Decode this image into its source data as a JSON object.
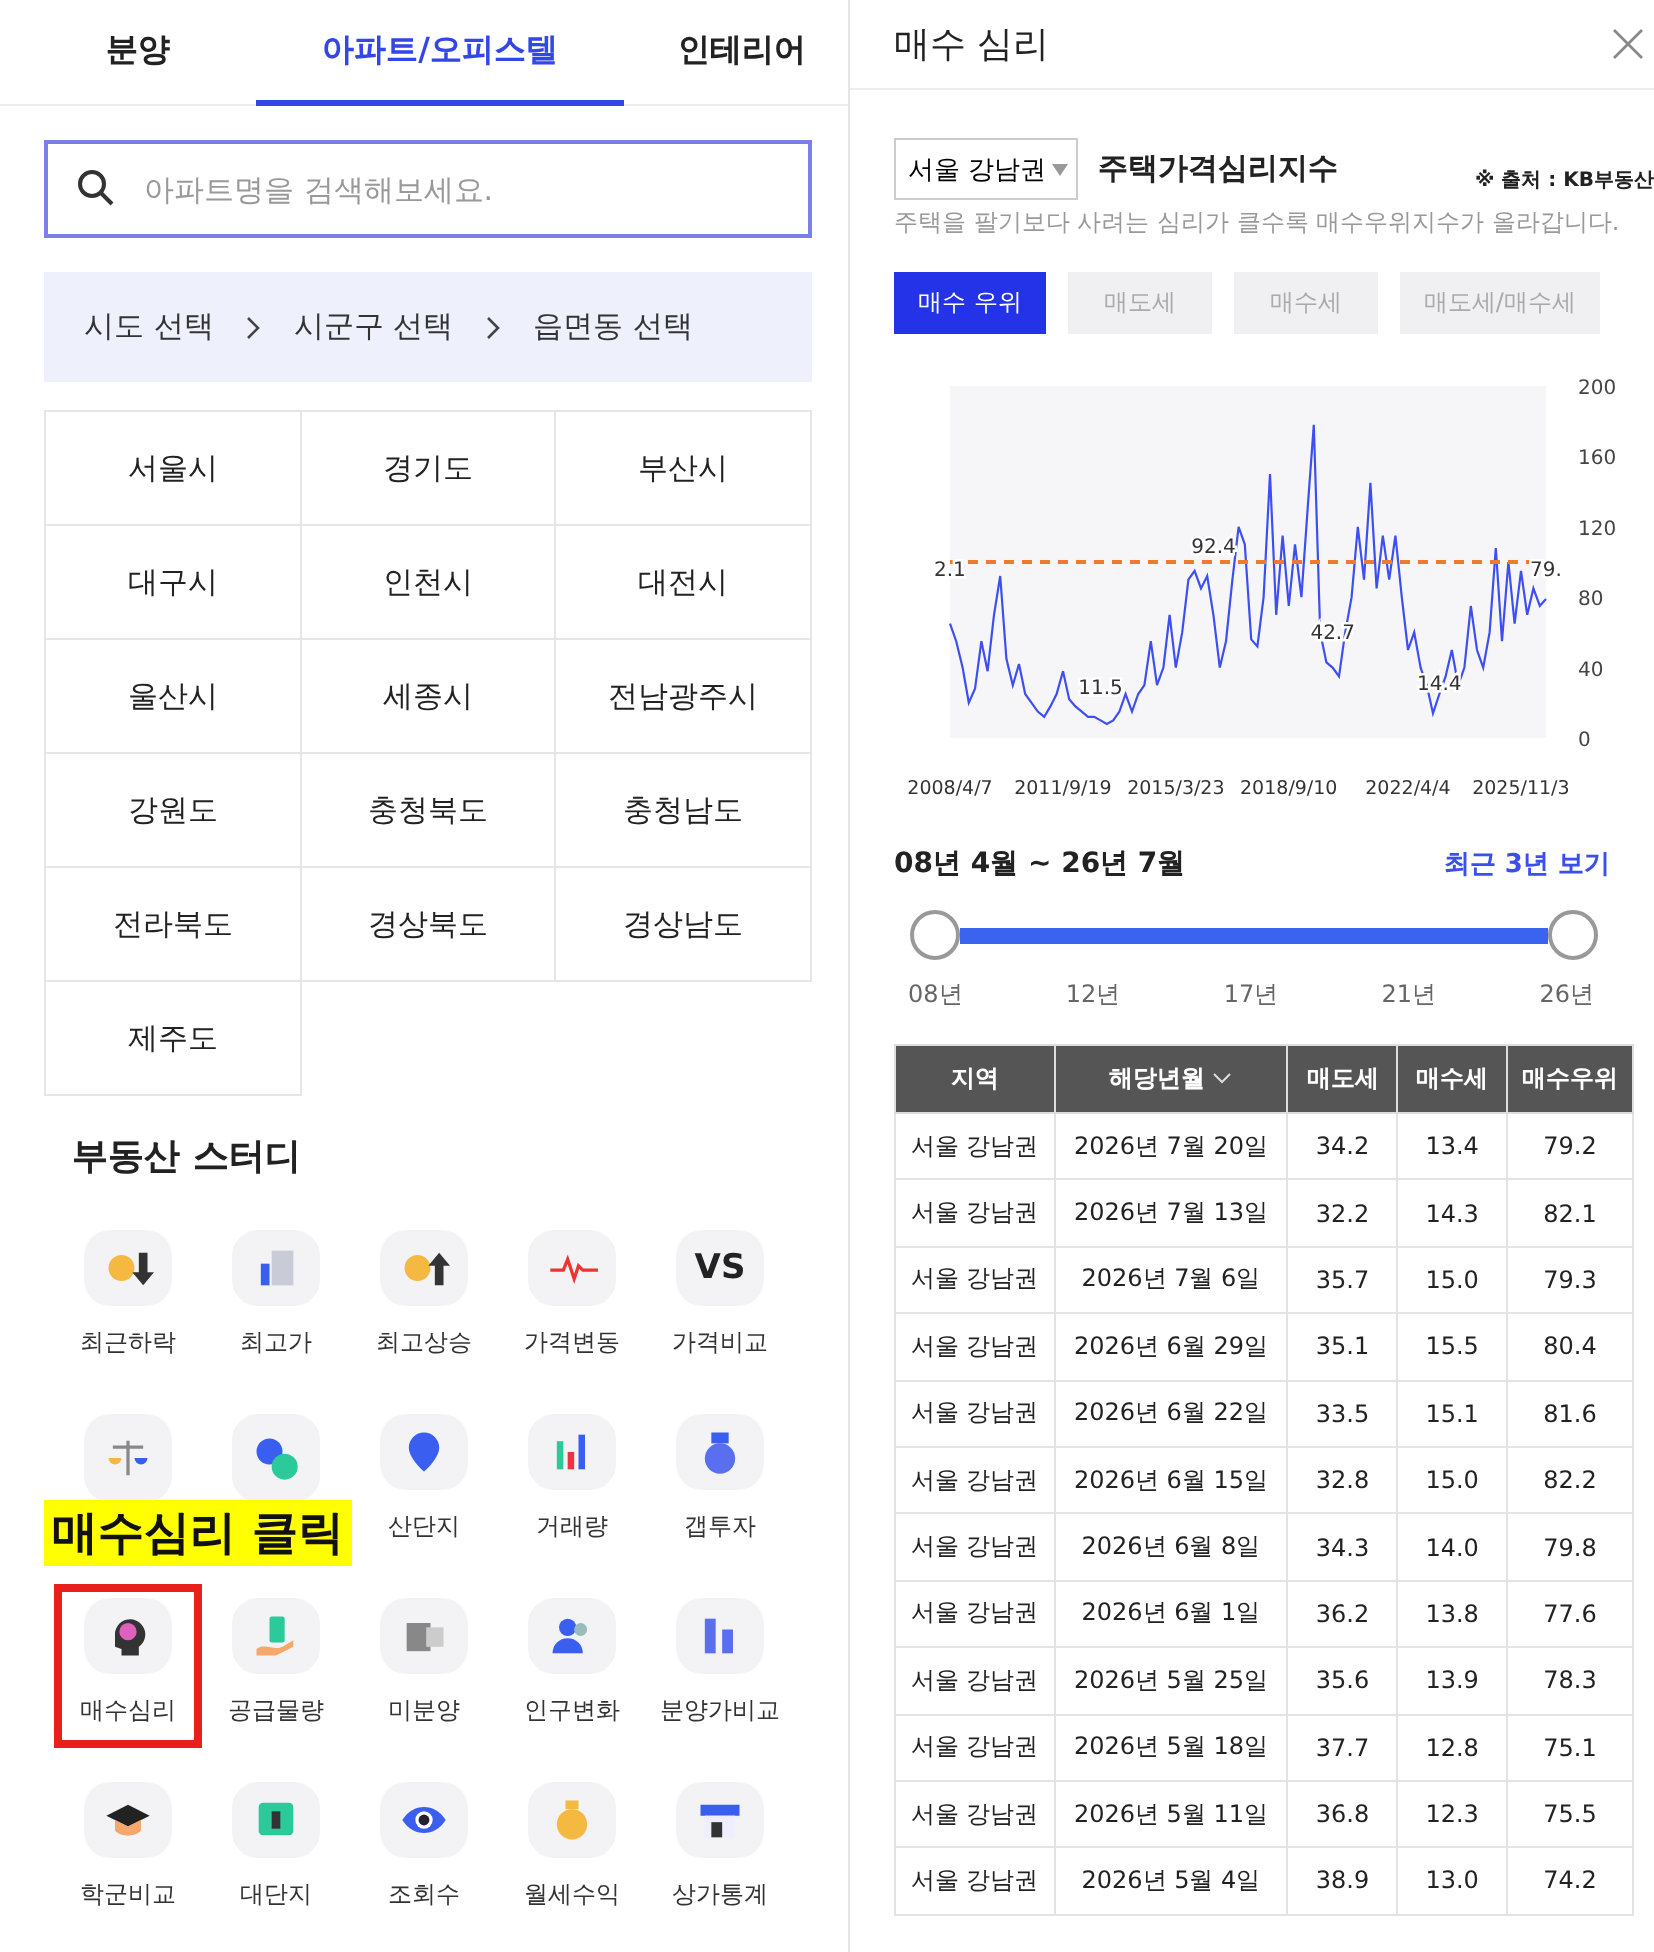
{
  "left_panel": {
    "tabs": [
      {
        "label": "분양",
        "selected": false
      },
      {
        "label": "아파트/오피스텔",
        "selected": true
      },
      {
        "label": "인테리어",
        "selected": false
      }
    ],
    "search": {
      "placeholder": "아파트명을 검색해보세요."
    },
    "breadcrumb": [
      "시도 선택",
      "시군구 선택",
      "읍면동 선택"
    ],
    "regions": [
      "서울시",
      "경기도",
      "부산시",
      "대구시",
      "인천시",
      "대전시",
      "울산시",
      "세종시",
      "전남광주시",
      "강원도",
      "충청북도",
      "충청남도",
      "전라북도",
      "경상북도",
      "경상남도",
      "제주도"
    ],
    "study_title": "부동산 스터디",
    "study_items": [
      {
        "label": "최근하락",
        "highlighted": false
      },
      {
        "label": "최고가",
        "highlighted": false
      },
      {
        "label": "최고상승",
        "highlighted": false
      },
      {
        "label": "가격변동",
        "highlighted": false
      },
      {
        "label": "가격비교",
        "icon_text": "VS",
        "highlighted": false
      },
      {
        "highlighted": false
      },
      {
        "highlighted": false
      },
      {
        "label": "산단지",
        "highlighted": false
      },
      {
        "label": "거래량",
        "highlighted": false
      },
      {
        "label": "갭투자",
        "highlighted": false
      },
      {
        "label": "매수심리",
        "highlighted": true
      },
      {
        "label": "공급물량",
        "highlighted": false
      },
      {
        "label": "미분양",
        "highlighted": false
      },
      {
        "label": "인구변화",
        "highlighted": false
      },
      {
        "label": "분양가비교",
        "highlighted": false
      },
      {
        "label": "학군비교",
        "highlighted": false
      },
      {
        "label": "대단지",
        "highlighted": false
      },
      {
        "label": "조회수",
        "highlighted": false
      },
      {
        "label": "월세수익",
        "highlighted": false
      },
      {
        "label": "상가통계",
        "highlighted": false
      }
    ],
    "callout": "매수심리 클릭"
  },
  "right_panel": {
    "title": "매수 심리",
    "region_select": "서울 강남권",
    "index_title": "주택가격심리지수",
    "source": "※ 출처 : KB부동산",
    "description": "주택을 팔기보다 사려는 심리가 클수록 매수우위지수가 올라갑니다.",
    "filters": [
      {
        "label": "매수 우위",
        "selected": true
      },
      {
        "label": "매도세",
        "selected": false
      },
      {
        "label": "매수세",
        "selected": false
      },
      {
        "label": "매도세/매수세",
        "selected": false
      }
    ],
    "chart_data": {
      "type": "line",
      "ylim": [
        0,
        200
      ],
      "yticks": [
        0,
        40,
        80,
        120,
        160,
        200
      ],
      "categories": [
        "2008/4/7",
        null,
        null,
        null,
        null,
        null,
        null,
        null,
        null,
        null,
        null,
        null,
        null,
        null,
        null,
        null,
        null,
        null,
        "2011/9/19",
        null,
        null,
        null,
        null,
        null,
        null,
        null,
        null,
        null,
        null,
        null,
        null,
        null,
        null,
        null,
        null,
        null,
        "2015/3/23",
        null,
        null,
        null,
        null,
        null,
        null,
        null,
        null,
        null,
        null,
        null,
        null,
        null,
        null,
        null,
        null,
        null,
        "2018/9/10",
        null,
        null,
        null,
        null,
        null,
        null,
        null,
        null,
        null,
        null,
        null,
        null,
        null,
        null,
        null,
        null,
        null,
        null,
        "2022/4/4",
        null,
        null,
        null,
        null,
        null,
        null,
        null,
        null,
        null,
        null,
        null,
        null,
        null,
        null,
        null,
        null,
        null,
        "2025/11/3",
        null,
        null,
        null,
        null
      ],
      "series": [
        {
          "color": "#3d4ff0",
          "values": [
            65,
            55,
            40,
            20,
            28,
            55,
            38,
            70,
            92,
            45,
            30,
            42,
            25,
            20,
            15,
            12,
            18,
            25,
            38,
            22,
            18,
            15,
            12,
            12,
            10,
            8,
            10,
            15,
            25,
            15,
            25,
            30,
            55,
            30,
            40,
            70,
            40,
            60,
            90,
            95,
            85,
            92,
            70,
            40,
            55,
            90,
            120,
            110,
            56,
            52,
            80,
            150,
            70,
            115,
            75,
            110,
            80,
            130,
            178,
            60,
            43,
            40,
            35,
            60,
            80,
            120,
            90,
            145,
            85,
            115,
            90,
            115,
            80,
            50,
            60,
            40,
            30,
            14,
            25,
            35,
            50,
            30,
            40,
            75,
            50,
            40,
            60,
            108,
            55,
            100,
            65,
            95,
            70,
            85,
            75,
            79
          ]
        }
      ],
      "ref_lines": [
        {
          "axis": "y",
          "value": 100,
          "color": "#f07a30"
        }
      ],
      "annotations": [
        "2.1",
        "11.5",
        "92.4",
        "42.7",
        "14.4",
        "79."
      ]
    },
    "range_label": "08년 4월 ~ 26년 7월",
    "recent_link": "최근 3년 보기",
    "slider": {
      "level": 1,
      "ticks": [
        "08년",
        "12년",
        "17년",
        "21년",
        "26년"
      ]
    },
    "table": {
      "columns": [
        "지역",
        "해당년월",
        "매도세",
        "매수세",
        "매수우위"
      ],
      "rows": [
        [
          "서울 강남권",
          "2026년 7월 20일",
          "34.2",
          "13.4",
          "79.2"
        ],
        [
          "서울 강남권",
          "2026년 7월 13일",
          "32.2",
          "14.3",
          "82.1"
        ],
        [
          "서울 강남권",
          "2026년 7월 6일",
          "35.7",
          "15.0",
          "79.3"
        ],
        [
          "서울 강남권",
          "2026년 6월 29일",
          "35.1",
          "15.5",
          "80.4"
        ],
        [
          "서울 강남권",
          "2026년 6월 22일",
          "33.5",
          "15.1",
          "81.6"
        ],
        [
          "서울 강남권",
          "2026년 6월 15일",
          "32.8",
          "15.0",
          "82.2"
        ],
        [
          "서울 강남권",
          "2026년 6월 8일",
          "34.3",
          "14.0",
          "79.8"
        ],
        [
          "서울 강남권",
          "2026년 6월 1일",
          "36.2",
          "13.8",
          "77.6"
        ],
        [
          "서울 강남권",
          "2026년 5월 25일",
          "35.6",
          "13.9",
          "78.3"
        ],
        [
          "서울 강남권",
          "2026년 5월 18일",
          "37.7",
          "12.8",
          "75.1"
        ],
        [
          "서울 강남권",
          "2026년 5월 11일",
          "36.8",
          "12.3",
          "75.5"
        ],
        [
          "서울 강남권",
          "2026년 5월 4일",
          "38.9",
          "13.0",
          "74.2"
        ]
      ]
    }
  }
}
